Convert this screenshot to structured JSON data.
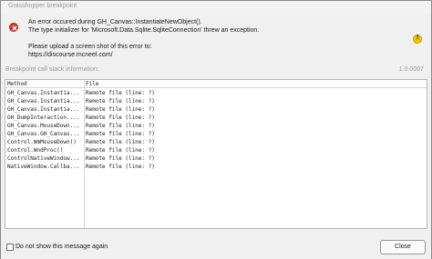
{
  "window": {
    "title": "Grasshopper breakpoint"
  },
  "message": {
    "line1": "An error occured during GH_Canvas::InstantiateNewObject().",
    "line2": "The type initializer for 'Microsoft.Data.Sqlite.SqliteConnection' threw an exception.",
    "line3": "Please upload a screen shot of this error to:",
    "line4": "https://discourse.mcneel.com/",
    "icon": "error-icon",
    "side_icon": "warning-icon"
  },
  "stack": {
    "label": "Breakpoint call stack information:",
    "version": "1.0.0007",
    "columns": {
      "method": "Method",
      "file": "File"
    },
    "rows": [
      {
        "method": "GH_Canvas.Instantia...",
        "file": "Remote file (line: ?)"
      },
      {
        "method": "GH_Canvas.Instantia...",
        "file": "Remote file (line: ?)"
      },
      {
        "method": "GH_Canvas.Instantia...",
        "file": "Remote file (line: ?)"
      },
      {
        "method": "GH_DumpInteraction....",
        "file": "Remote file (line: ?)"
      },
      {
        "method": "GH_Canvas.MouseDown...",
        "file": "Remote file (line: ?)"
      },
      {
        "method": "GH_Canvas.GH_Canvas...",
        "file": "Remote file (line: ?)"
      },
      {
        "method": "Control.WmMouseDown()",
        "file": "Remote file (line: ?)"
      },
      {
        "method": "Control.WndProc()",
        "file": "Remote file (line: ?)"
      },
      {
        "method": "ControlNativeWindow...",
        "file": "Remote file (line: ?)"
      },
      {
        "method": "NativeWindow.Callba...",
        "file": "Remote file (line: ?)"
      }
    ]
  },
  "footer": {
    "checkbox_label": "Do not show this message again",
    "checkbox_checked": false,
    "close_label": "Close"
  }
}
